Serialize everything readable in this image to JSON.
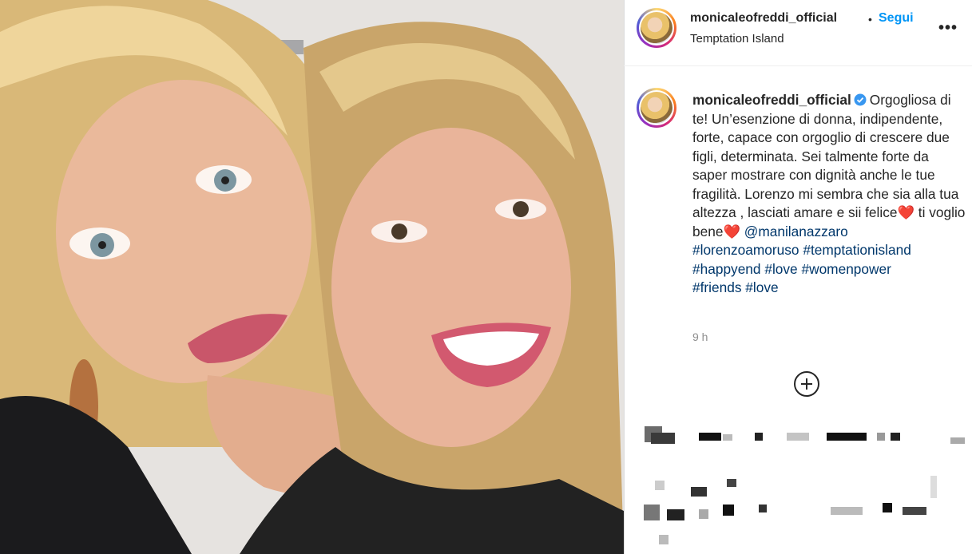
{
  "post": {
    "username": "monicaleofreddi_official",
    "follow_separator": "•",
    "follow_label": "Segui",
    "location": "Temptation Island",
    "more_label": "•••"
  },
  "caption": {
    "username": "monicaleofreddi_official",
    "text": "Orgogliosa di te! Un’esenzione di donna, indipendente, forte, capace con orgoglio di crescere due figli, determinata. Sei talmente forte da saper mostrare con dignità anche le tue fragilità. Lorenzo mi sembra che sia alla tua altezza , lasciati amare e sii felice",
    "heart1": "❤️",
    "tail": "ti voglio bene",
    "heart2": "❤️",
    "mention": "@manilanazzaro",
    "hashtags": [
      "#lorenzoamoruso",
      "#temptationisland",
      "#happyend",
      "#love",
      "#womenpower",
      "#friends",
      "#love"
    ],
    "timestamp": "9 h"
  },
  "icons": {
    "verified": "verified-badge-icon",
    "load_more": "plus-circle-icon",
    "options": "more-options-icon"
  },
  "colors": {
    "link_blue": "#0095f6",
    "hashtag_blue": "#00376b",
    "heart_red": "#ed4956",
    "text": "#262626",
    "muted": "#8e8e8e"
  }
}
